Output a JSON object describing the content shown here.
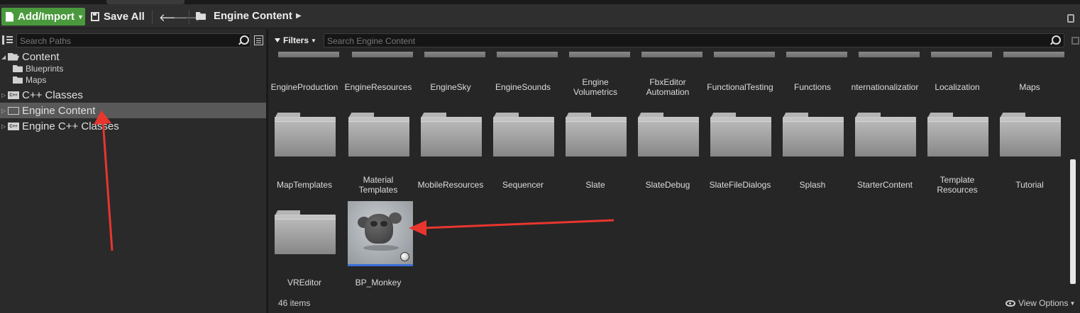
{
  "toolbar": {
    "add_import_label": "Add/Import",
    "save_all_label": "Save All",
    "breadcrumb": "Engine Content"
  },
  "left_panel": {
    "search_placeholder": "Search Paths",
    "tree": [
      {
        "label": "Content",
        "expanded": true
      },
      {
        "label": "Blueprints"
      },
      {
        "label": "Maps"
      },
      {
        "label": "C++ Classes"
      },
      {
        "label": "Engine Content",
        "selected": true
      },
      {
        "label": "Engine C++ Classes"
      }
    ]
  },
  "right_panel": {
    "filters_label": "Filters",
    "search_placeholder": "Search Engine Content",
    "row1_labels": [
      "EngineProduction",
      "EngineResources",
      "EngineSky",
      "EngineSounds",
      "Engine\nVolumetrics",
      "FbxEditor\nAutomation",
      "FunctionalTesting",
      "Functions",
      "nternationalizatior",
      "Localization",
      "Maps"
    ],
    "row2_labels": [
      "MapTemplates",
      "Material\nTemplates",
      "MobileResources",
      "Sequencer",
      "Slate",
      "SlateDebug",
      "SlateFileDialogs",
      "Splash",
      "StarterContent",
      "Template\nResources",
      "Tutorial"
    ],
    "row3_labels": [
      "VREditor",
      "BP_Monkey"
    ],
    "items_count": "46 items",
    "view_options_label": "View Options"
  },
  "colors": {
    "accent_green": "#4a9a3d",
    "annotation_red": "#e8362f",
    "selection_blue": "#3a6fd8"
  }
}
